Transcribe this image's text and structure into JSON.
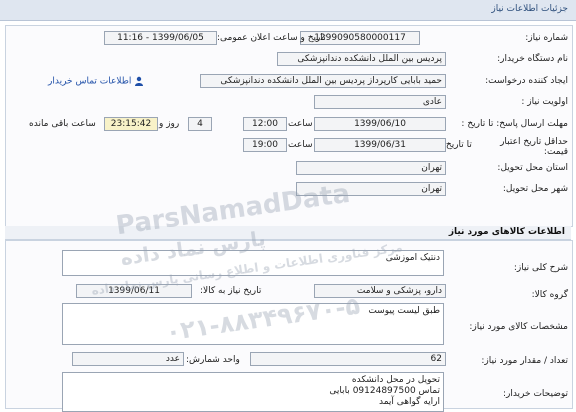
{
  "header": {
    "title": "جزئیات اطلاعات نیاز"
  },
  "labels": {
    "need_number": "شماره نیاز:",
    "announce_datetime": "تاریخ و ساعت اعلان عمومی:",
    "buyer_org": "نام دستگاه خریدار:",
    "requester": "ایجاد کننده درخواست:",
    "priority": "اولویت نیاز :",
    "deadline_send": "مهلت ارسال پاسخ: تا تاریخ :",
    "time_word": "ساعت",
    "days_and": "روز و",
    "remaining": "ساعت باقی مانده",
    "price_validity": "حداقل تاریخ اعتبار قیمت:",
    "until_date": "تا تاریخ :",
    "delivery_province": "استان محل تحویل:",
    "delivery_city": "شهر محل تحویل:",
    "goods_section": "اطلاعات کالاهای مورد نیاز",
    "summary": "شرح کلی نیاز:",
    "goods_group": "گروه کالا:",
    "need_date": "تاریخ نیاز به کالا:",
    "specs": "مشخصات کالای مورد نیاز:",
    "quantity": "تعداد / مقدار مورد نیاز:",
    "unit": "واحد شمارش:",
    "buyer_notes": "توضیحات خریدار:"
  },
  "fields": {
    "need_number": "1299090580000117",
    "announce_datetime": "1399/06/05 - 11:16",
    "buyer_org": "پردیس بین الملل دانشکده دندانپزشکی",
    "requester": "حمید بابایی کارپرداز پردیس بین الملل دانشکده دندانپزشکی",
    "contact_link": "اطلاعات تماس خریدار",
    "priority": "عادی",
    "deadline_date": "1399/06/10",
    "deadline_time": "12:00",
    "remaining_days": "4",
    "remaining_time": "23:15:42",
    "validity_date": "1399/06/31",
    "validity_time": "19:00",
    "province": "تهران",
    "city": "تهران",
    "summary": "دنتیک اموزشی",
    "goods_group": "دارو، پزشکی و سلامت",
    "need_date": "1399/06/11",
    "specs": "طبق لیست پیوست",
    "quantity": "62",
    "unit": "عدد",
    "notes_line1": "تحویل در محل دانشکده",
    "notes_line2": "تماس 09124897500  بابایی",
    "notes_line3": "ارایه گواهی آیمد"
  },
  "watermark": {
    "line1": "ParsNamadData",
    "line2": "پارس نماد داده",
    "line3": "مرکز فناوری اطلاعات و اطلاع رسانی پارس نماد داده",
    "phone": "۰۲۱-۸۸۳۴۹۶۷۰-۵"
  }
}
